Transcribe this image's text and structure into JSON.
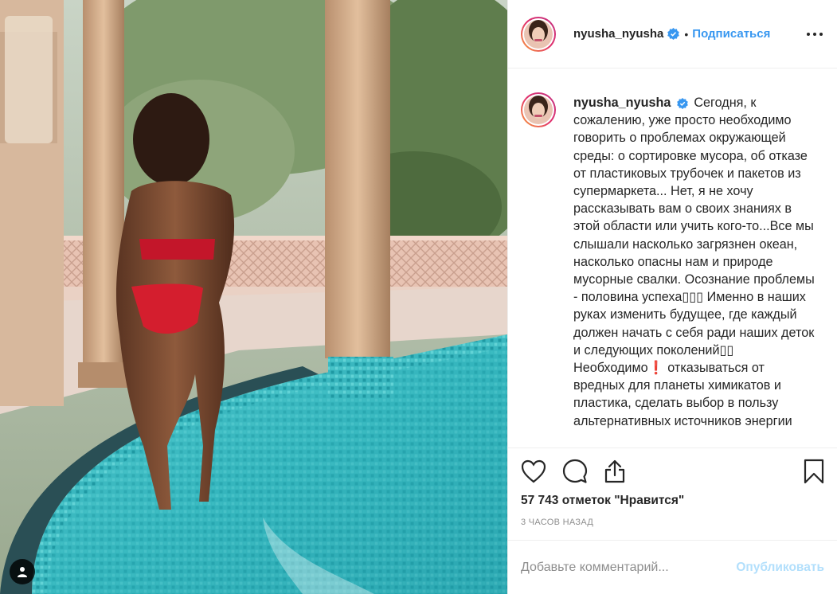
{
  "post": {
    "photo_alt": "",
    "username": "nyusha_nyusha",
    "verified": true,
    "follow_label": "Подписаться",
    "separator": "•",
    "caption": "Сегодня, к сожалению, уже просто необходимо говорить о проблемах окружающей среды: о сортировке мусора, об отказе от пластиковых трубочек и пакетов из супермаркета... Нет, я не хочу рассказывать вам о своих знаниях в этой области или учить кого-то...Все мы слышали насколько загрязнен океан, насколько опасны нам и природе мусорные свалки. Осознание проблемы - половина успеха▯▯▯ Именно в наших руках изменить будущее, где каждый должен начать с себя ради наших деток и следующих поколений▯▯ Необходимо❗ отказываться от вредных для планеты химикатов и пластика, сделать выбор в пользу альтернативных источников энергии",
    "likes_text": "57 743 отметок \"Нравится\"",
    "time_text": "3 часов назад"
  },
  "comment": {
    "placeholder": "Добавьте комментарий...",
    "publish_label": "Опубликовать"
  },
  "icons": {
    "heart": "heart-icon",
    "comment": "comment-icon",
    "share": "share-icon",
    "bookmark": "bookmark-icon",
    "more": "more-options-icon",
    "verified": "verified-badge-icon",
    "user_tag": "user-tag-icon"
  },
  "colors": {
    "accent": "#3897f0",
    "publish_disabled": "#b2dffc",
    "muted": "#8e8e8e",
    "verified": "#3897f0"
  }
}
